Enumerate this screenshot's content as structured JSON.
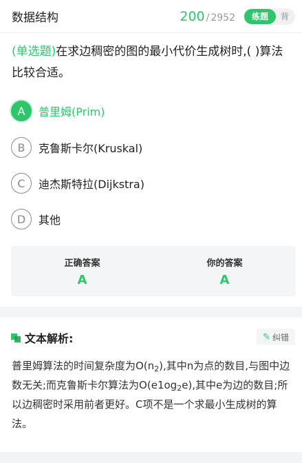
{
  "header": {
    "title": "数据结构",
    "progress_current": "200",
    "progress_sep": "/",
    "progress_total": "2952",
    "mode_active": "练题",
    "mode_inactive": "背"
  },
  "question": {
    "tag": "(单选题)",
    "text": "在求边稠密的图的最小代价生成树时,(      )算法比较合适。"
  },
  "options": [
    {
      "letter": "A",
      "text": "普里姆(Prim)",
      "selected": true
    },
    {
      "letter": "B",
      "text": "克鲁斯卡尔(Kruskal)",
      "selected": false
    },
    {
      "letter": "C",
      "text": "迪杰斯特拉(Dijkstra)",
      "selected": false
    },
    {
      "letter": "D",
      "text": "其他",
      "selected": false
    }
  ],
  "answers": {
    "correct_label": "正确答案",
    "correct_value": "A",
    "yours_label": "你的答案",
    "yours_value": "A"
  },
  "analysis": {
    "heading": "文本解析:",
    "fix_label": "纠错",
    "p1": "普里姆算法的时间复杂度为O(n",
    "p1_sub": "2",
    "p2": "),其中n为点的数目,与图中边数无关;而克鲁斯卡尔算法为O(e1og",
    "p2_sub": "2",
    "p3": "e),其中e为边的数目;所以边稠密时采用前者更好。C项不是一个求最小生成树的算法。"
  },
  "colors": {
    "accent": "#2ec56b",
    "background": "#f3f4f6"
  }
}
